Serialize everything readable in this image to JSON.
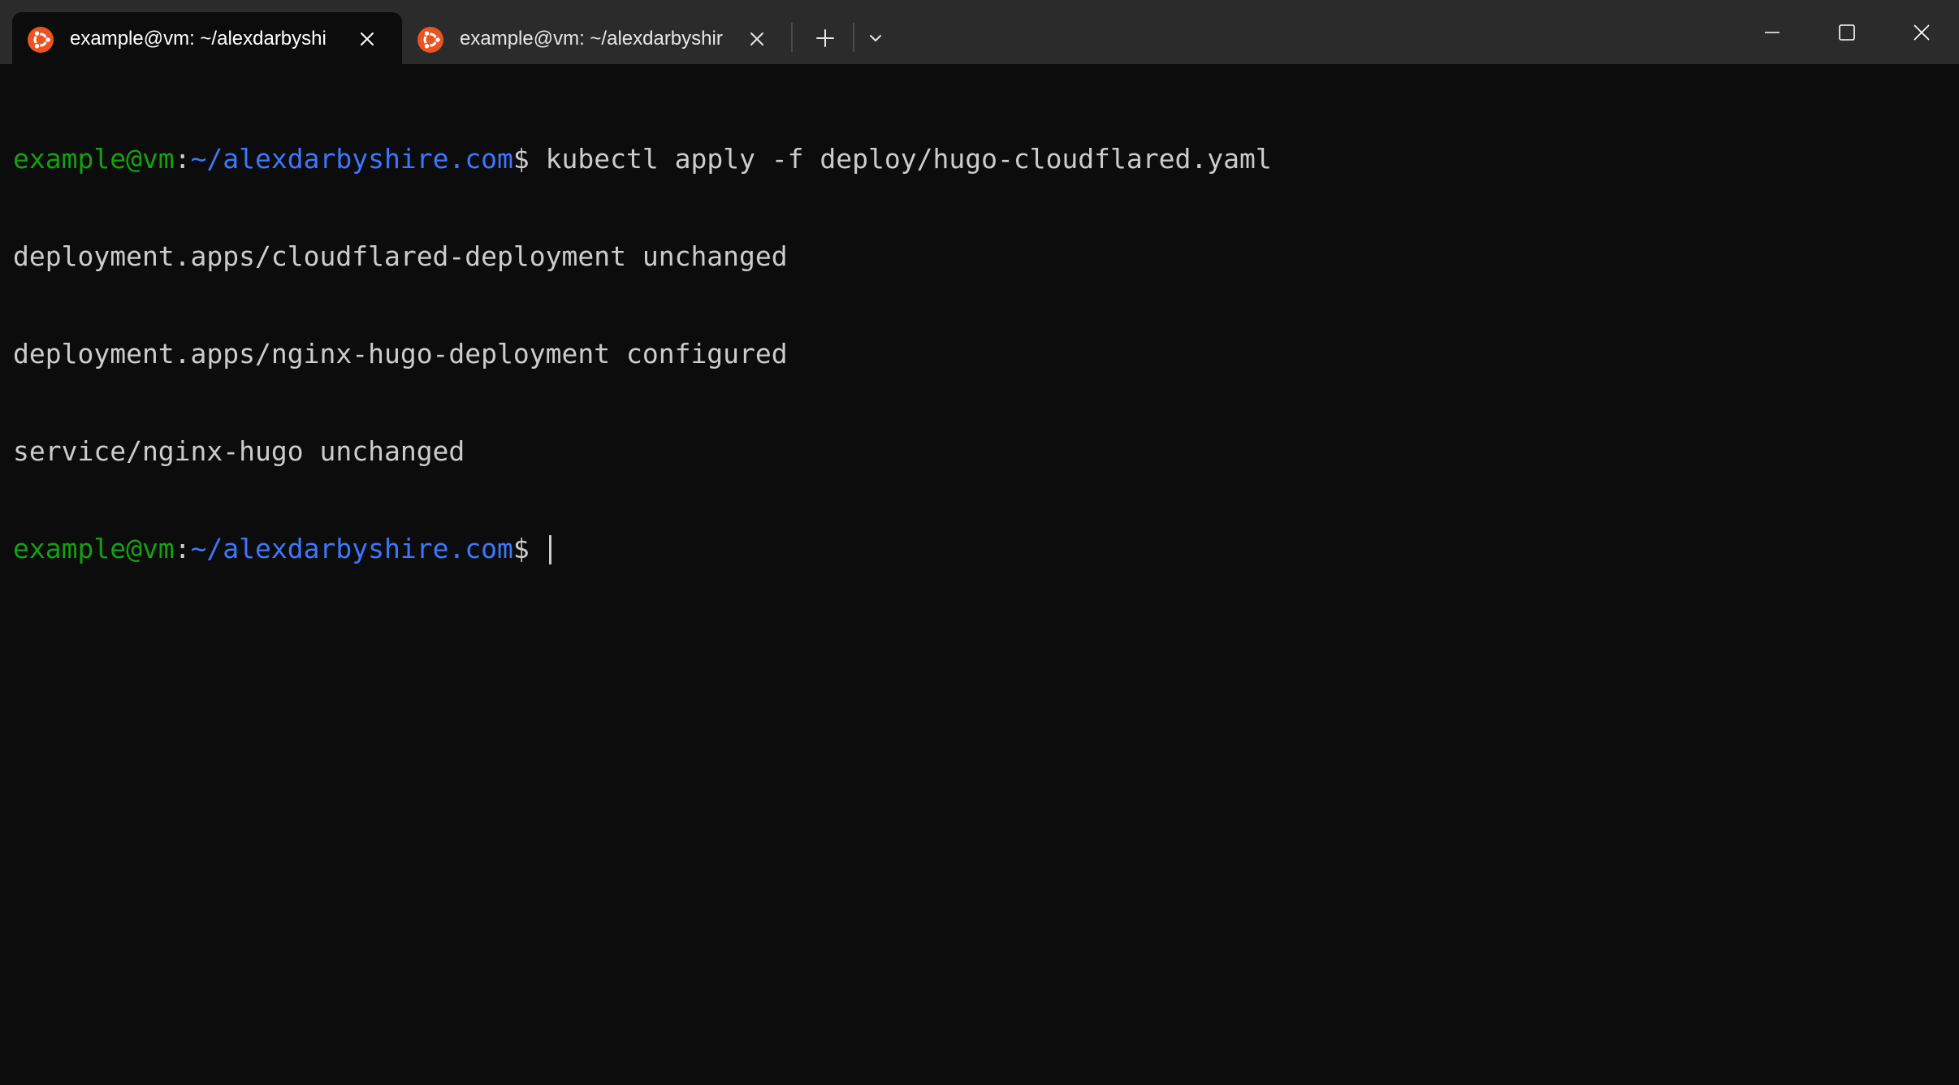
{
  "tabs": [
    {
      "title": "example@vm: ~/alexdarbyshi",
      "icon": "ubuntu-icon",
      "active": true
    },
    {
      "title": "example@vm: ~/alexdarbyshir",
      "icon": "ubuntu-icon",
      "active": false
    }
  ],
  "tab_bar": {
    "new_tab_icon": "plus-icon",
    "dropdown_icon": "chevron-down-icon"
  },
  "window_controls": {
    "minimize_icon": "minimize-icon",
    "maximize_icon": "maximize-icon",
    "close_icon": "close-icon"
  },
  "terminal": {
    "prompt_user": "example@vm",
    "prompt_colon": ":",
    "prompt_path": "~/alexdarbyshire.com",
    "prompt_dollar": "$",
    "command": " kubectl apply -f deploy/hugo-cloudflared.yaml",
    "output": [
      "deployment.apps/cloudflared-deployment unchanged",
      "deployment.apps/nginx-hugo-deployment configured",
      "service/nginx-hugo unchanged"
    ],
    "current_input": " "
  },
  "colors": {
    "background": "#0c0c0c",
    "titlebar": "#2b2b2b",
    "prompt_user": "#13a10e",
    "prompt_path": "#3b78ff",
    "text": "#cccccc",
    "ubuntu_orange": "#e95420"
  }
}
